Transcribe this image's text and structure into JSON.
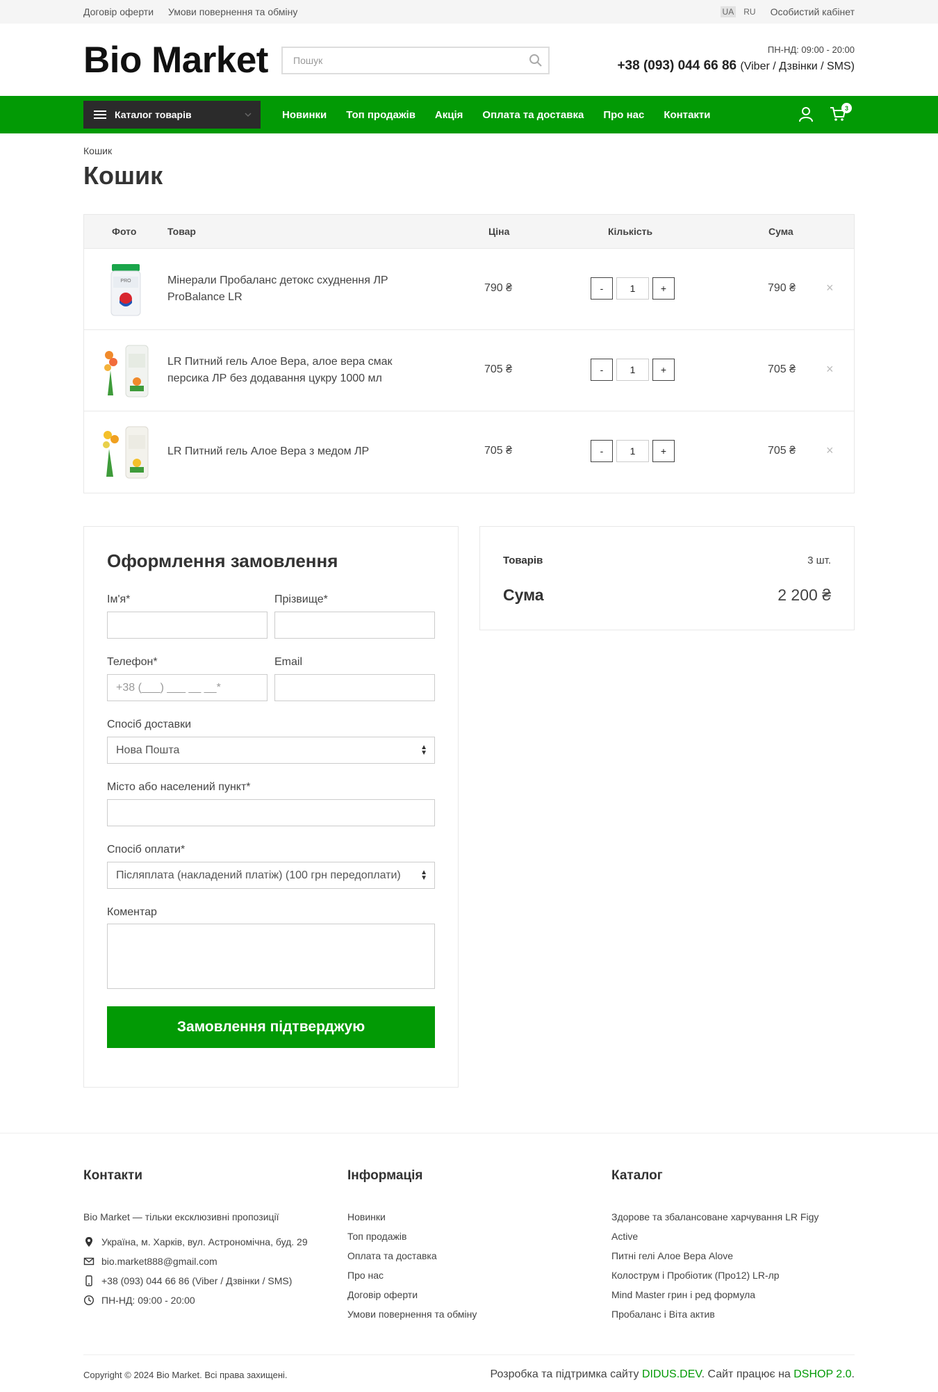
{
  "topbar": {
    "links": [
      "Договір оферти",
      "Умови повернення та обміну"
    ],
    "lang_ua": "UA",
    "lang_ru": "RU",
    "cabinet": "Особистий кабінет"
  },
  "header": {
    "logo": "Bio Market",
    "search_placeholder": "Пошук",
    "hours": "ПН-НД: 09:00 - 20:00",
    "phone": "+38 (093) 044 66 86",
    "phone_note": "(Viber / Дзвінки / SMS)"
  },
  "nav": {
    "catalog": "Каталог товарів",
    "items": [
      "Новинки",
      "Топ продажів",
      "Акція",
      "Оплата та доставка",
      "Про нас",
      "Контакти"
    ],
    "cart_count": "3",
    "accent": "#029a05"
  },
  "page": {
    "breadcrumb": "Кошик",
    "title": "Кошик"
  },
  "cart": {
    "headers": {
      "photo": "Фото",
      "product": "Товар",
      "price": "Ціна",
      "qty": "Кількість",
      "sum": "Сума"
    },
    "items": [
      {
        "name": "Мінерали Пробаланс детокс схуднення ЛР ProBalance LR",
        "price": "790 ₴",
        "qty": "1",
        "sum": "790 ₴"
      },
      {
        "name": "LR Питний гель Алое Вера, алое вера смак персика ЛР без додавання цукру 1000 мл",
        "price": "705 ₴",
        "qty": "1",
        "sum": "705 ₴"
      },
      {
        "name": "LR Питний гель Алое Вера з медом ЛР",
        "price": "705 ₴",
        "qty": "1",
        "sum": "705 ₴"
      }
    ],
    "minus": "-",
    "plus": "+",
    "remove": "×"
  },
  "checkout": {
    "title": "Оформлення замовлення",
    "first_name_label": "Ім'я*",
    "last_name_label": "Прізвище*",
    "phone_label": "Телефон*",
    "phone_placeholder": "+38 (___) ___ __ __*",
    "email_label": "Email",
    "delivery_label": "Спосіб доставки",
    "delivery_value": "Нова Пошта",
    "city_label": "Місто або населений пункт*",
    "payment_label": "Спосіб оплати*",
    "payment_value": "Післяплата (накладений платіж) (100 грн передоплати)",
    "comment_label": "Коментар",
    "submit": "Замовлення підтверджую"
  },
  "summary": {
    "items_label": "Товарів",
    "items_value": "3 шт.",
    "total_label": "Сума",
    "total_value": "2 200 ₴"
  },
  "footer": {
    "contacts_title": "Контакти",
    "intro": "Bio Market — тільки ексклюзивні пропозиції",
    "address": "Україна, м. Харків, вул. Астрономічна, буд. 29",
    "email": "bio.market888@gmail.com",
    "phone": "+38 (093) 044 66 86 (Viber / Дзвінки / SMS)",
    "hours": "ПН-НД: 09:00 - 20:00",
    "info_title": "Інформація",
    "info_links": [
      "Новинки",
      "Топ продажів",
      "Оплата та доставка",
      "Про нас",
      "Договір оферти",
      "Умови повернення та обміну"
    ],
    "catalog_title": "Каталог",
    "catalog_links": [
      "Здорове та збалансоване харчування LR Figy",
      "Active",
      "Питні гелі Алое Вера Alove",
      "Колострум і Пробіотик (Про12) LR-лр",
      "Mind Master грин і ред формула",
      "Пробаланс і Віта актив"
    ],
    "copyright": "Copyright © 2024 Bio Market. Всі права захищені.",
    "dev_prefix": "Розробка та підтримка сайту",
    "dev_link": "DIDUS.DEV",
    "dev_middle": ". Сайт працює на",
    "cms_link": "DSHOP 2.0",
    "dev_suffix": "."
  }
}
